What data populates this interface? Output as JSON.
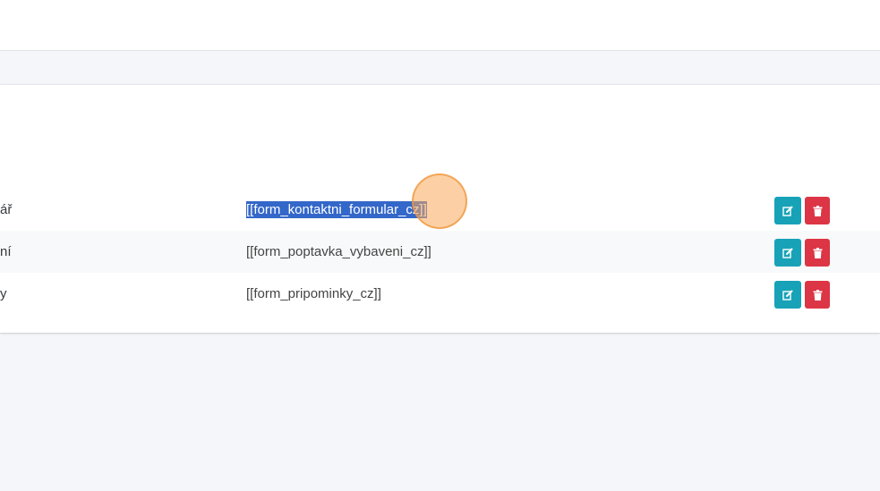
{
  "table": {
    "rows": [
      {
        "name": "ář",
        "code": "[[form_kontaktni_formular_cz]]",
        "selected": true
      },
      {
        "name": "ní",
        "code": "[[form_poptavka_vybaveni_cz]]",
        "selected": false
      },
      {
        "name": "y",
        "code": "[[form_pripominky_cz]]",
        "selected": false
      }
    ]
  },
  "colors": {
    "edit_button": "#17a2b8",
    "delete_button": "#dc3545",
    "selection": "#3367c9",
    "cursor_highlight": "#f5a25a"
  },
  "icons": {
    "edit": "edit-icon",
    "delete": "trash-icon"
  }
}
